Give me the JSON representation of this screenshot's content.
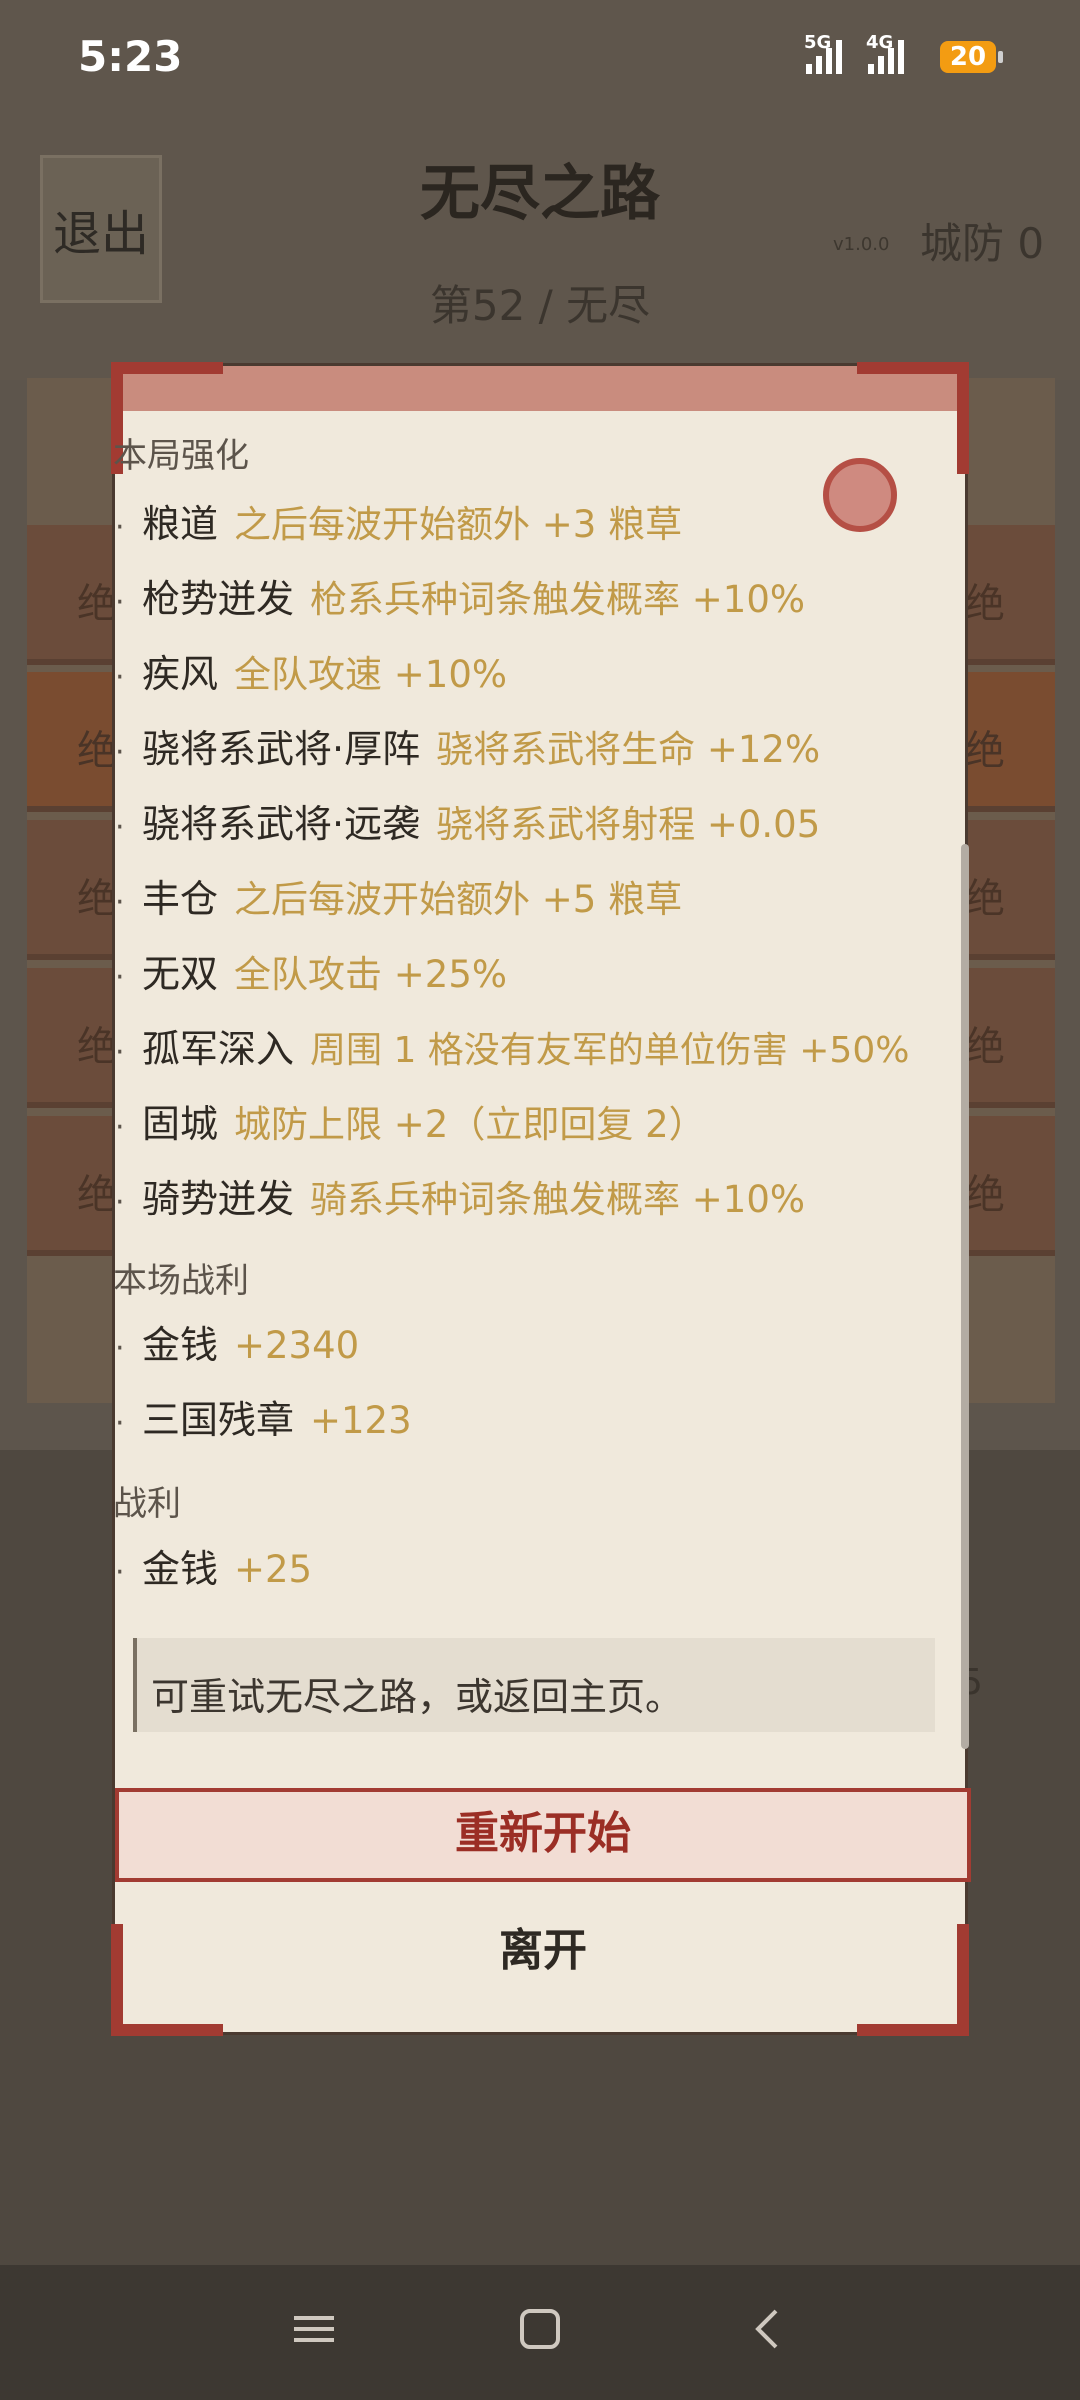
{
  "status_bar": {
    "time": "5:23",
    "signal_1_label": "5G",
    "signal_2_label": "4G",
    "battery": "20"
  },
  "background": {
    "exit_label": "退出",
    "title": "无尽之路",
    "wave": "第52 / 无尽",
    "version": "v1.0.0",
    "city_defense": "城防 0",
    "row_left": "绝",
    "row_right": "绝",
    "side_number": "5"
  },
  "dialog": {
    "section_buffs": "本局强化",
    "buffs": [
      {
        "name": "粮道",
        "effect": "之后每波开始额外 +3 粮草"
      },
      {
        "name": "枪势迸发",
        "effect": "枪系兵种词条触发概率 +10%"
      },
      {
        "name": "疾风",
        "effect": "全队攻速 +10%"
      },
      {
        "name": "骁将系武将·厚阵",
        "effect": "骁将系武将生命 +12%"
      },
      {
        "name": "骁将系武将·远袭",
        "effect": "骁将系武将射程 +0.05"
      },
      {
        "name": "丰仓",
        "effect": "之后每波开始额外 +5 粮草"
      },
      {
        "name": "无双",
        "effect": "全队攻击 +25%"
      },
      {
        "name": "孤军深入",
        "effect": "周围 1 格没有友军的单位伤害 +50%"
      },
      {
        "name": "固城",
        "effect": "城防上限 +2（立即回复 2）"
      },
      {
        "name": "骑势迸发",
        "effect": "骑系兵种词条触发概率 +10%"
      }
    ],
    "section_battle_loot": "本场战利",
    "battle_loot": [
      {
        "name": "金钱",
        "effect": "+2340"
      },
      {
        "name": "三国残章",
        "effect": "+123"
      }
    ],
    "section_loot": "战利",
    "loot": [
      {
        "name": "金钱",
        "effect": "+25"
      }
    ],
    "note": "可重试无尽之路，或返回主页。",
    "restart_label": "重新开始",
    "leave_label": "离开"
  },
  "colors": {
    "accent_red": "#a23b32",
    "effect_gold": "#c19a48",
    "paper": "#f0e9dc"
  },
  "nav": {
    "menu_icon": "menu-icon",
    "home_icon": "home-icon",
    "back_icon": "back-icon"
  }
}
